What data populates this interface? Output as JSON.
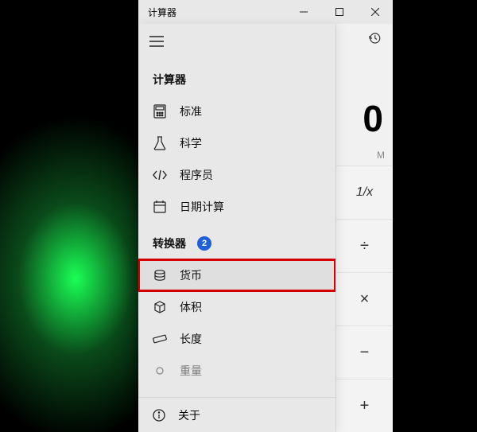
{
  "window": {
    "title": "计算器"
  },
  "display": {
    "value": "0",
    "memory": "M"
  },
  "ops": {
    "frac": "1/x",
    "div": "÷",
    "mul": "×",
    "sub": "−",
    "add": "+"
  },
  "drawer": {
    "section_calc": "计算器",
    "section_conv": "转换器",
    "badge": "2",
    "items_calc": [
      {
        "label": "标准"
      },
      {
        "label": "科学"
      },
      {
        "label": "程序员"
      },
      {
        "label": "日期计算"
      }
    ],
    "items_conv": [
      {
        "label": "货币"
      },
      {
        "label": "体积"
      },
      {
        "label": "长度"
      },
      {
        "label": "重量"
      }
    ],
    "about": "关于"
  }
}
